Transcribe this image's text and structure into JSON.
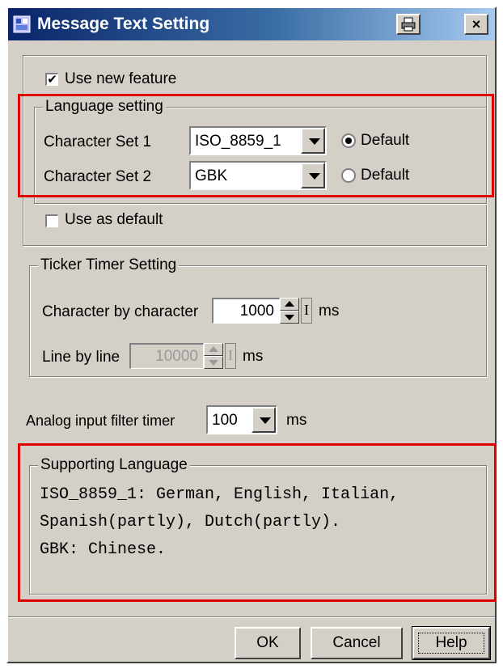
{
  "window": {
    "title": "Message Text Setting",
    "print_icon": "printer-icon",
    "close_label": "×"
  },
  "use_new_feature": {
    "label": "Use new feature",
    "checked": true
  },
  "language_setting": {
    "title": "Language setting",
    "rows": [
      {
        "label": "Character Set 1",
        "value": "ISO_8859_1",
        "radio_label": "Default",
        "radio_selected": true
      },
      {
        "label": "Character Set 2",
        "value": "GBK",
        "radio_label": "Default",
        "radio_selected": false
      }
    ]
  },
  "use_as_default": {
    "label": "Use as default",
    "checked": false
  },
  "ticker": {
    "title": "Ticker Timer Setting",
    "char_label": "Character by character",
    "char_value": "1000",
    "char_unit": "ms",
    "line_label": "Line by line",
    "line_value": "10000",
    "line_unit": "ms"
  },
  "analog": {
    "label": "Analog input filter timer",
    "value": "100",
    "unit": "ms"
  },
  "supporting": {
    "title": "Supporting Language",
    "lines": [
      "ISO_8859_1: German, English, Italian,",
      "Spanish(partly), Dutch(partly).",
      "GBK: Chinese."
    ]
  },
  "buttons": {
    "ok": "OK",
    "cancel": "Cancel",
    "help": "Help"
  },
  "colors": {
    "highlight": "#e00000",
    "titlebar_start": "#0a246a",
    "titlebar_end": "#a6caf0"
  }
}
